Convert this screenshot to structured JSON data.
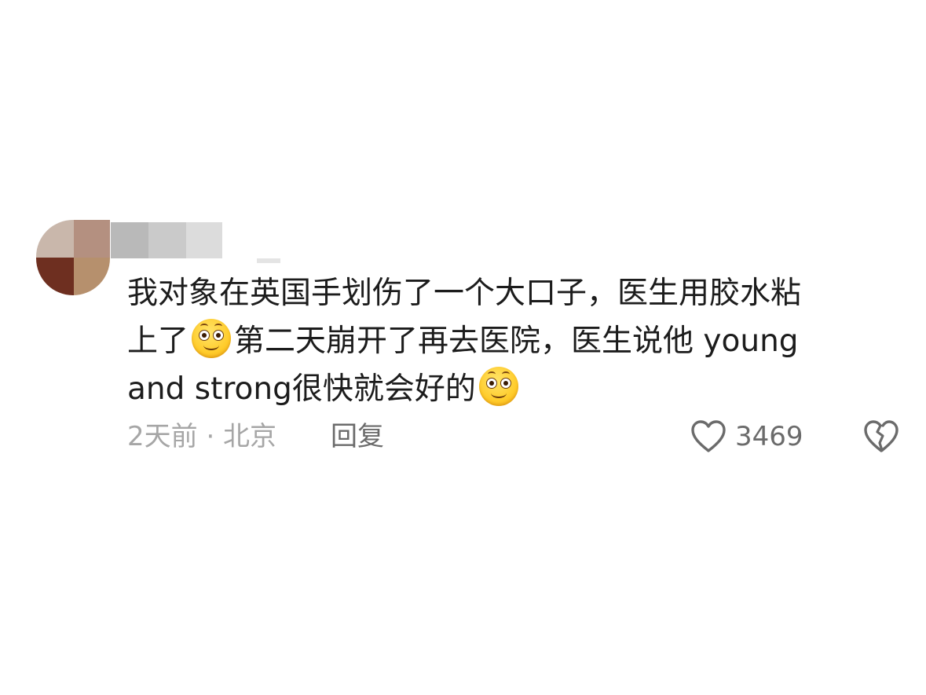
{
  "comment": {
    "text_line1": "我对象在英国手划伤了一个大口子，医生用胶水粘",
    "text_part2a": "上了",
    "emoji_1": "smiling-face-emoji",
    "text_part2b": "第二天崩开了再去医院，医生说他 young",
    "text_part3": "and strong很快就会好的",
    "emoji_2": "smiling-face-emoji",
    "meta": "2天前 · 北京",
    "reply_label": "回复",
    "like_count": "3469",
    "like_icon": "heart-outline-icon",
    "dislike_icon": "broken-heart-icon"
  }
}
